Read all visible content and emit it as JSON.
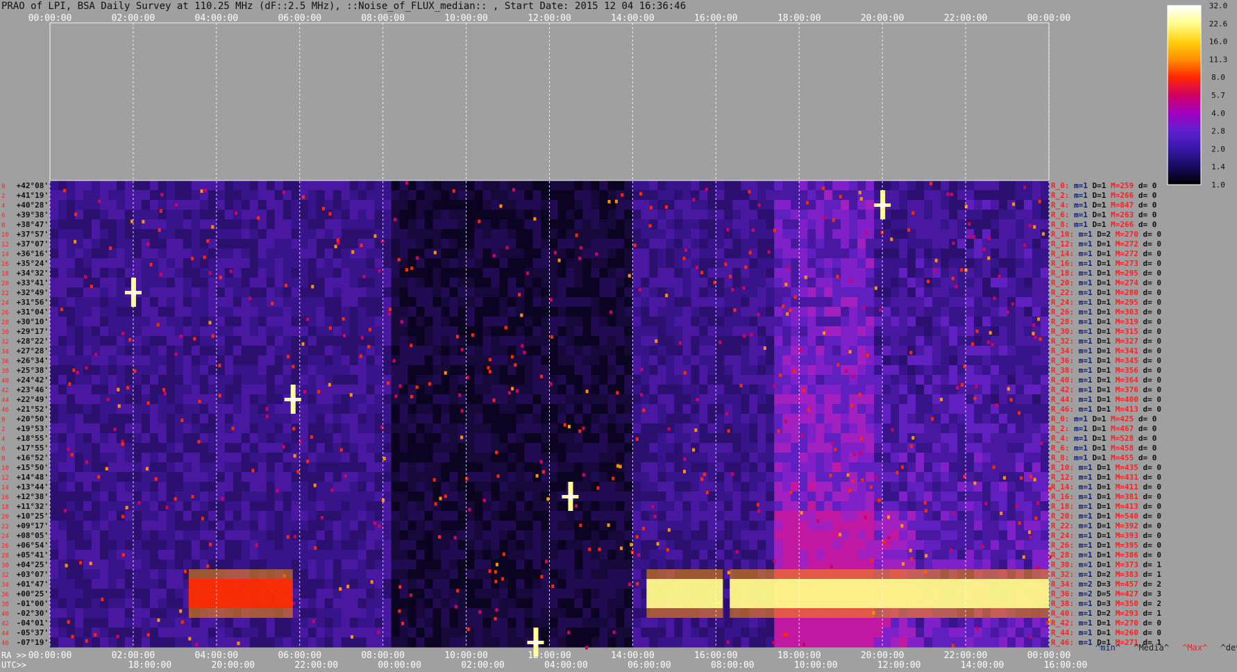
{
  "title": "PRAO of LPI, BSA Daily Survey at 110.25 MHz (dF::2.5 MHz), ::Noise_of_FLUX_median:: , Start Date: 2015 12 04 16:36:46",
  "colorbar": {
    "labels": [
      "32.0",
      "22.6",
      "16.0",
      "11.3",
      "8.0",
      "5.7",
      "4.0",
      "2.8",
      "2.0",
      "1.4",
      "1.0"
    ],
    "colors": [
      "#ffffff",
      "#ffff90",
      "#ffd010",
      "#ff9000",
      "#ff2800",
      "#d00060",
      "#a000c0",
      "#6020d0",
      "#3818a8",
      "#180a60",
      "#000000"
    ]
  },
  "colors": {
    "background": "#a0a0a0",
    "plot_bg": "#3a1090",
    "ra_label": "#101010",
    "row_index": "#ff2020"
  },
  "chart_data": {
    "type": "heatmap",
    "title": "PRAO of LPI, BSA Daily Survey at 110.25 MHz (dF::2.5 MHz), ::Noise_of_FLUX_median:: , Start Date: 2015 12 04 16:36:46",
    "top_axis_labels": [
      "00:00:00",
      "02:00:00",
      "04:00:00",
      "06:00:00",
      "08:00:00",
      "10:00:00",
      "12:00:00",
      "14:00:00",
      "16:00:00",
      "18:00:00",
      "20:00:00",
      "22:00:00",
      "00:00:00"
    ],
    "ra_axis_title": "RA >>",
    "ra_axis_labels": [
      "00:00:00",
      "02:00:00",
      "04:00:00",
      "06:00:00",
      "08:00:00",
      "10:00:00",
      "12:00:00",
      "14:00:00",
      "16:00:00",
      "18:00:00",
      "20:00:00",
      "22:00:00",
      "00:00:00"
    ],
    "utc_axis_title": "UTC>>",
    "utc_axis_labels": [
      "18:00:00",
      "20:00:00",
      "22:00:00",
      "00:00:00",
      "02:00:00",
      "04:00:00",
      "06:00:00",
      "08:00:00",
      "10:00:00",
      "12:00:00",
      "14:00:00",
      "16:00:00"
    ],
    "declinations": [
      "+42°08'",
      "+41°19'",
      "+40°28'",
      "+39°38'",
      "+38°47'",
      "+37°57'",
      "+37°07'",
      "+36°16'",
      "+35°24'",
      "+34°32'",
      "+33°41'",
      "+32°49'",
      "+31°56'",
      "+31°04'",
      "+30°10'",
      "+29°17'",
      "+28°22'",
      "+27°28'",
      "+26°34'",
      "+25°38'",
      "+24°42'",
      "+23°46'",
      "+22°49'",
      "+21°52'",
      "+20°50'",
      "+19°53'",
      "+18°55'",
      "+17°55'",
      "+16°52'",
      "+15°50'",
      "+14°48'",
      "+13°44'",
      "+12°38'",
      "+11°32'",
      "+10°25'",
      "+09°17'",
      "+08°05'",
      "+06°54'",
      "+05°41'",
      "+04°25'",
      "+03°07'",
      "+01°47'",
      "+00°25'",
      "-01°00'",
      "-02°30'",
      "-04°01'",
      "-05°37'",
      "-07°19'"
    ],
    "row_index_labels": [
      "0",
      "2",
      "4",
      "6",
      "8",
      "10",
      "12",
      "14",
      "16",
      "18",
      "20",
      "22",
      "24",
      "26",
      "28",
      "30",
      "32",
      "34",
      "36",
      "38",
      "40",
      "42",
      "44",
      "46",
      "0",
      "2",
      "4",
      "6",
      "8",
      "10",
      "12",
      "14",
      "16",
      "18",
      "20",
      "22",
      "24",
      "26",
      "28",
      "30",
      "32",
      "34",
      "36",
      "38",
      "40",
      "42",
      "44",
      "46"
    ],
    "row_stats": [
      {
        "r": "R_0:",
        "m": "m=1",
        "D": "D=1",
        "M": "M=259",
        "d": "d= 0"
      },
      {
        "r": "R_2:",
        "m": "m=1",
        "D": "D=1",
        "M": "M=266",
        "d": "d= 0"
      },
      {
        "r": "R_4:",
        "m": "m=1",
        "D": "D=1",
        "M": "M=847",
        "d": "d= 0"
      },
      {
        "r": "R_6:",
        "m": "m=1",
        "D": "D=1",
        "M": "M=263",
        "d": "d= 0"
      },
      {
        "r": "R_8:",
        "m": "m=1",
        "D": "D=1",
        "M": "M=266",
        "d": "d= 0"
      },
      {
        "r": "R_10:",
        "m": "m=1",
        "D": "D=2",
        "M": "M=270",
        "d": "d= 0"
      },
      {
        "r": "R_12:",
        "m": "m=1",
        "D": "D=1",
        "M": "M=272",
        "d": "d= 0"
      },
      {
        "r": "R_14:",
        "m": "m=1",
        "D": "D=1",
        "M": "M=272",
        "d": "d= 0"
      },
      {
        "r": "R_16:",
        "m": "m=1",
        "D": "D=1",
        "M": "M=273",
        "d": "d= 0"
      },
      {
        "r": "R_18:",
        "m": "m=1",
        "D": "D=1",
        "M": "M=295",
        "d": "d= 0"
      },
      {
        "r": "R_20:",
        "m": "m=1",
        "D": "D=1",
        "M": "M=274",
        "d": "d= 0"
      },
      {
        "r": "R_22:",
        "m": "m=1",
        "D": "D=1",
        "M": "M=280",
        "d": "d= 0"
      },
      {
        "r": "R_24:",
        "m": "m=1",
        "D": "D=1",
        "M": "M=295",
        "d": "d= 0"
      },
      {
        "r": "R_26:",
        "m": "m=1",
        "D": "D=1",
        "M": "M=303",
        "d": "d= 0"
      },
      {
        "r": "R_28:",
        "m": "m=1",
        "D": "D=1",
        "M": "M=319",
        "d": "d= 0"
      },
      {
        "r": "R_30:",
        "m": "m=1",
        "D": "D=1",
        "M": "M=315",
        "d": "d= 0"
      },
      {
        "r": "R_32:",
        "m": "m=1",
        "D": "D=1",
        "M": "M=327",
        "d": "d= 0"
      },
      {
        "r": "R_34:",
        "m": "m=1",
        "D": "D=1",
        "M": "M=341",
        "d": "d= 0"
      },
      {
        "r": "R_36:",
        "m": "m=1",
        "D": "D=1",
        "M": "M=345",
        "d": "d= 0"
      },
      {
        "r": "R_38:",
        "m": "m=1",
        "D": "D=1",
        "M": "M=356",
        "d": "d= 0"
      },
      {
        "r": "R_40:",
        "m": "m=1",
        "D": "D=1",
        "M": "M=364",
        "d": "d= 0"
      },
      {
        "r": "R_42:",
        "m": "m=1",
        "D": "D=1",
        "M": "M=376",
        "d": "d= 0"
      },
      {
        "r": "R_44:",
        "m": "m=1",
        "D": "D=1",
        "M": "M=400",
        "d": "d= 0"
      },
      {
        "r": "R_46:",
        "m": "m=1",
        "D": "D=1",
        "M": "M=413",
        "d": "d= 0"
      },
      {
        "r": "R_0:",
        "m": "m=1",
        "D": "D=1",
        "M": "M=425",
        "d": "d= 0"
      },
      {
        "r": "R_2:",
        "m": "m=1",
        "D": "D=1",
        "M": "M=467",
        "d": "d= 0"
      },
      {
        "r": "R_4:",
        "m": "m=1",
        "D": "D=1",
        "M": "M=528",
        "d": "d= 0"
      },
      {
        "r": "R_6:",
        "m": "m=1",
        "D": "D=1",
        "M": "M=458",
        "d": "d= 0"
      },
      {
        "r": "R_8:",
        "m": "m=1",
        "D": "D=1",
        "M": "M=455",
        "d": "d= 0"
      },
      {
        "r": "R_10:",
        "m": "m=1",
        "D": "D=1",
        "M": "M=435",
        "d": "d= 0"
      },
      {
        "r": "R_12:",
        "m": "m=1",
        "D": "D=1",
        "M": "M=431",
        "d": "d= 0"
      },
      {
        "r": "R_14:",
        "m": "m=1",
        "D": "D=1",
        "M": "M=411",
        "d": "d= 0"
      },
      {
        "r": "R_16:",
        "m": "m=1",
        "D": "D=1",
        "M": "M=381",
        "d": "d= 0"
      },
      {
        "r": "R_18:",
        "m": "m=1",
        "D": "D=1",
        "M": "M=413",
        "d": "d= 0"
      },
      {
        "r": "R_20:",
        "m": "m=1",
        "D": "D=1",
        "M": "M=540",
        "d": "d= 0"
      },
      {
        "r": "R_22:",
        "m": "m=1",
        "D": "D=1",
        "M": "M=392",
        "d": "d= 0"
      },
      {
        "r": "R_24:",
        "m": "m=1",
        "D": "D=1",
        "M": "M=393",
        "d": "d= 0"
      },
      {
        "r": "R_26:",
        "m": "m=1",
        "D": "D=1",
        "M": "M=395",
        "d": "d= 0"
      },
      {
        "r": "R_28:",
        "m": "m=1",
        "D": "D=1",
        "M": "M=386",
        "d": "d= 0"
      },
      {
        "r": "R_30:",
        "m": "m=1",
        "D": "D=1",
        "M": "M=373",
        "d": "d= 1"
      },
      {
        "r": "R_32:",
        "m": "m=1",
        "D": "D=2",
        "M": "M=383",
        "d": "d= 1"
      },
      {
        "r": "R_34:",
        "m": "m=2",
        "D": "D=3",
        "M": "M=457",
        "d": "d= 2"
      },
      {
        "r": "R_36:",
        "m": "m=2",
        "D": "D=5",
        "M": "M=427",
        "d": "d= 3"
      },
      {
        "r": "R_38:",
        "m": "m=1",
        "D": "D=3",
        "M": "M=350",
        "d": "d= 2"
      },
      {
        "r": "R_40:",
        "m": "m=1",
        "D": "D=2",
        "M": "M=293",
        "d": "d= 1"
      },
      {
        "r": "R_42:",
        "m": "m=1",
        "D": "D=1",
        "M": "M=270",
        "d": "d= 0"
      },
      {
        "r": "R_44:",
        "m": "m=1",
        "D": "D=1",
        "M": "M=260",
        "d": "d= 0"
      },
      {
        "r": "R_46:",
        "m": "m=1",
        "D": "D=1",
        "M": "M=271",
        "d": "d= 1"
      }
    ],
    "footer_legend": [
      "^min^",
      "^Media^",
      "^Max^",
      "^devia^"
    ],
    "bright_bands": [
      {
        "dec": "+00°25'",
        "ra_start": "03:20:00",
        "ra_end": "05:50:00",
        "level": "8.0"
      },
      {
        "dec": "+00°25'",
        "ra_start": "14:20:00",
        "ra_end": "16:10:00",
        "level": "22.6"
      },
      {
        "dec": "+00°25'",
        "ra_start": "16:20:00",
        "ra_end": "00:00:00",
        "level": "22.6"
      }
    ],
    "point_sources": [
      {
        "ra": "20:00:00",
        "dec": "+40°28'",
        "level": "32.0"
      },
      {
        "ra": "05:50:00",
        "dec": "+22°49'",
        "level": "16.0"
      },
      {
        "ra": "12:30:00",
        "dec": "+12°38'",
        "level": "16.0"
      },
      {
        "ra": "02:00:00",
        "dec": "+32°49'",
        "level": "16.0"
      },
      {
        "ra": "11:40:00",
        "dec": "-07°19'",
        "level": "32.0"
      }
    ],
    "colorbar_range": [
      1.0,
      32.0
    ],
    "scale": "log"
  }
}
